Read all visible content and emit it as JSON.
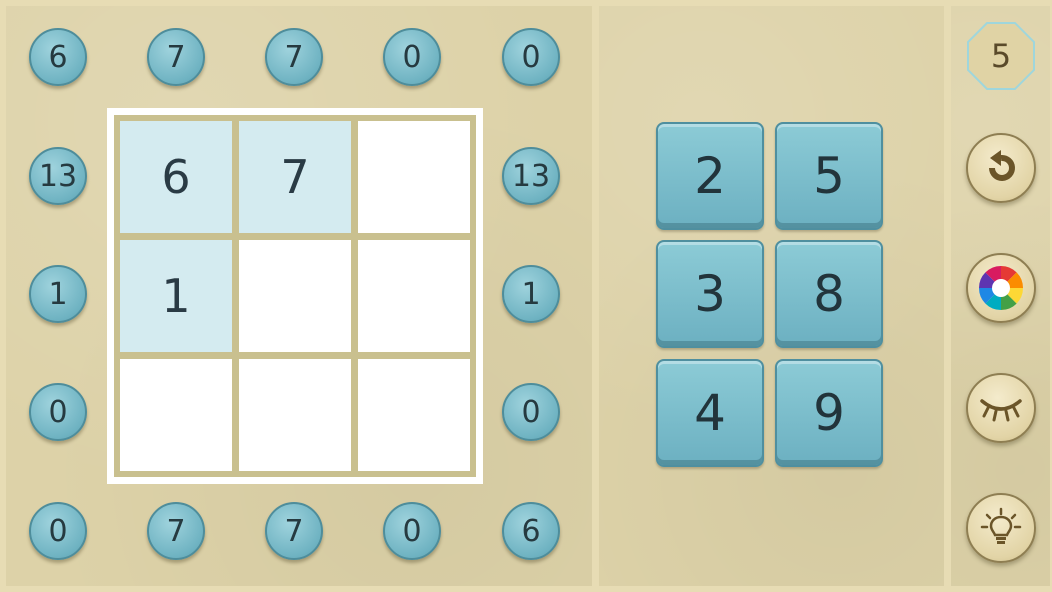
{
  "clues": {
    "top": [
      "6",
      "7",
      "7",
      "0",
      "0"
    ],
    "left": [
      "13",
      "1",
      "0"
    ],
    "right": [
      "13",
      "1",
      "0"
    ],
    "bottom": [
      "0",
      "7",
      "7",
      "0",
      "6"
    ]
  },
  "grid": {
    "cells": [
      {
        "value": "6",
        "given": true
      },
      {
        "value": "7",
        "given": true
      },
      {
        "value": "",
        "given": false
      },
      {
        "value": "1",
        "given": true
      },
      {
        "value": "",
        "given": false
      },
      {
        "value": "",
        "given": false
      },
      {
        "value": "",
        "given": false
      },
      {
        "value": "",
        "given": false
      },
      {
        "value": "",
        "given": false
      }
    ]
  },
  "keypad": {
    "keys": [
      "2",
      "5",
      "3",
      "8",
      "4",
      "9"
    ]
  },
  "toolbar": {
    "level": "5",
    "icons": [
      "undo-icon",
      "color-wheel-icon",
      "eye-closed-icon",
      "lightbulb-icon"
    ]
  },
  "colors": {
    "background": "#ddd2a8",
    "clue": "#6fb3c2",
    "given_cell": "#d4ebf0",
    "key": "#7cbecc",
    "tool": "#e6d9ad",
    "icon": "#6b5529"
  }
}
